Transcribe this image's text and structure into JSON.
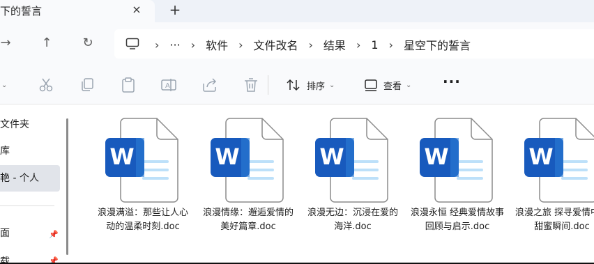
{
  "tab": {
    "title": "下的誓言",
    "close": "×",
    "new_tab": "+"
  },
  "nav": {
    "back": "→",
    "up": "↑",
    "refresh": "↻"
  },
  "breadcrumb": {
    "overflow": "···",
    "items": [
      "软件",
      "文件改名",
      "结果",
      "1",
      "星空下的誓言"
    ],
    "separator": "›"
  },
  "toolbar": {
    "sort_label": "排序",
    "view_label": "查看",
    "more": "···",
    "chevron": "⌄"
  },
  "sidebar": {
    "items": [
      {
        "label": "文件夹",
        "selected": false
      },
      {
        "label": "库",
        "selected": false
      },
      {
        "label": "艳 - 个人",
        "selected": true
      },
      {
        "label": "面",
        "pinned": true
      },
      {
        "label": "载",
        "pinned": true
      }
    ],
    "pin": "📌"
  },
  "files": [
    {
      "name": "浪漫满溢：那些让人心动的温柔时刻.doc"
    },
    {
      "name": "浪漫情缘：邂逅爱情的美好篇章.doc"
    },
    {
      "name": "浪漫无边：沉浸在爱的海洋.doc"
    },
    {
      "name": "浪漫永恒 经典爱情故事回顾与启示.doc"
    },
    {
      "name": "浪漫之旅 探寻爱情中的甜蜜瞬间.doc"
    }
  ],
  "icons": {
    "file_type": "word-document-icon",
    "word_letter": "W",
    "accent": "#185abd",
    "accent_light": "#41a5ee"
  }
}
